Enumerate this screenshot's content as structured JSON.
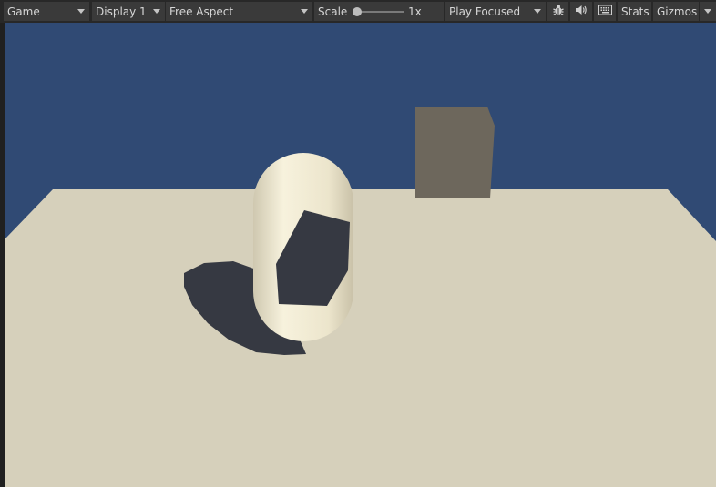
{
  "toolbar": {
    "view_select": "Game",
    "display_select": "Display 1",
    "aspect_select": "Free Aspect",
    "scale_label": "Scale",
    "scale_value": "1x",
    "scale_level": 0,
    "play_mode_select": "Play Focused",
    "stats_label": "Stats",
    "gizmos_label": "Gizmos",
    "icons": {
      "bug": "bug-icon",
      "audio": "speaker-icon",
      "keyboard": "keyboard-icon"
    }
  },
  "scene": {
    "sky_color": "#304a74",
    "ground_color": "#d6d0bb",
    "capsule_color": "#f0ead4",
    "cube_color": "#6d675c",
    "shadow_color": "#363942"
  }
}
